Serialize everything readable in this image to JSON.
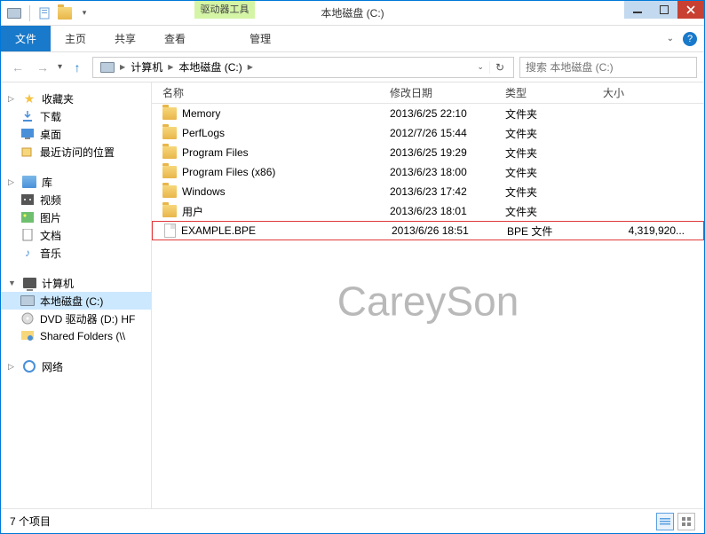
{
  "window": {
    "contextual_tab": "驱动器工具",
    "title": "本地磁盘 (C:)"
  },
  "ribbon": {
    "file": "文件",
    "home": "主页",
    "share": "共享",
    "view": "查看",
    "manage": "管理"
  },
  "breadcrumb": {
    "items": [
      "计算机",
      "本地磁盘 (C:)"
    ]
  },
  "search": {
    "placeholder": "搜索 本地磁盘 (C:)"
  },
  "nav": {
    "favorites": {
      "label": "收藏夹",
      "items": [
        "下载",
        "桌面",
        "最近访问的位置"
      ]
    },
    "libraries": {
      "label": "库",
      "items": [
        "视频",
        "图片",
        "文档",
        "音乐"
      ]
    },
    "computer": {
      "label": "计算机",
      "items": [
        "本地磁盘 (C:)",
        "DVD 驱动器 (D:) HF",
        "Shared Folders (\\\\"
      ]
    },
    "network": {
      "label": "网络"
    }
  },
  "columns": {
    "name": "名称",
    "date": "修改日期",
    "type": "类型",
    "size": "大小"
  },
  "files": [
    {
      "name": "Memory",
      "date": "2013/6/25 22:10",
      "type": "文件夹",
      "size": "",
      "kind": "folder"
    },
    {
      "name": "PerfLogs",
      "date": "2012/7/26 15:44",
      "type": "文件夹",
      "size": "",
      "kind": "folder"
    },
    {
      "name": "Program Files",
      "date": "2013/6/25 19:29",
      "type": "文件夹",
      "size": "",
      "kind": "folder"
    },
    {
      "name": "Program Files (x86)",
      "date": "2013/6/23 18:00",
      "type": "文件夹",
      "size": "",
      "kind": "folder"
    },
    {
      "name": "Windows",
      "date": "2013/6/23 17:42",
      "type": "文件夹",
      "size": "",
      "kind": "folder"
    },
    {
      "name": "用户",
      "date": "2013/6/23 18:01",
      "type": "文件夹",
      "size": "",
      "kind": "folder"
    },
    {
      "name": "EXAMPLE.BPE",
      "date": "2013/6/26 18:51",
      "type": "BPE 文件",
      "size": "4,319,920...",
      "kind": "file",
      "highlight": true
    }
  ],
  "status": {
    "count": "7 个项目"
  },
  "watermark": "CareySon"
}
